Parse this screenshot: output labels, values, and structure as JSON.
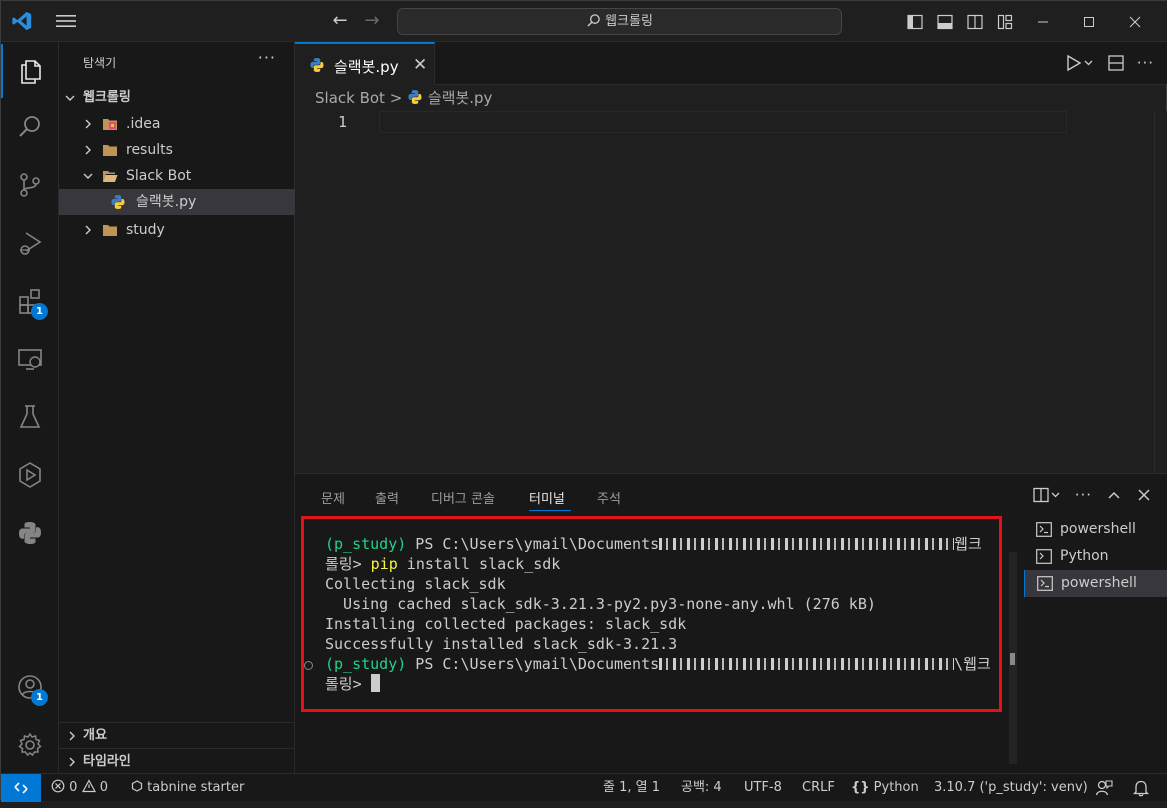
{
  "titlebar": {
    "search_text": "웹크롤링"
  },
  "activity": {
    "extensions_badge": "1",
    "accounts_badge": "1"
  },
  "sidebar": {
    "title": "탐색기",
    "more": "···",
    "root": "웹크롤링",
    "items": [
      {
        "label": ".idea"
      },
      {
        "label": "results"
      },
      {
        "label": "Slack Bot"
      },
      {
        "label": "슬랙봇.py"
      },
      {
        "label": "study"
      }
    ],
    "outline_label": "개요",
    "timeline_label": "타임라인"
  },
  "editor": {
    "tab_label": "슬랙봇.py",
    "tab_close": "✕",
    "breadcrumb_folder": "Slack Bot",
    "breadcrumb_sep": ">",
    "breadcrumb_file": "슬랙봇.py",
    "line_number": "1"
  },
  "panel": {
    "tabs": [
      "문제",
      "출력",
      "디버그 콘솔",
      "터미널",
      "주석"
    ],
    "active_tab": "터미널",
    "terminal": {
      "prompt_env": "(p_study)",
      "prompt_ps": " PS C:\\Users\\ymail\\Documents",
      "path_tail_1": "웹크",
      "path_tail_2": "\\웹크",
      "prompt_end": "롤링>",
      "cmd_pip": "pip",
      "cmd_rest": " install slack_sdk",
      "line3": "Collecting slack_sdk",
      "line4": "  Using cached slack_sdk-3.21.3-py2.py3-none-any.whl (276 kB)",
      "line5": "Installing collected packages: slack_sdk",
      "line6": "Successfully installed slack_sdk-3.21.3"
    },
    "terminal_list": [
      "powershell",
      "Python",
      "powershell"
    ]
  },
  "statusbar": {
    "errors": "0",
    "warnings": "0",
    "tabnine": "tabnine starter",
    "position": "줄 1, 열 1",
    "spaces": "공백: 4",
    "encoding": "UTF-8",
    "eol": "CRLF",
    "language": "Python",
    "interpreter": "3.10.7 ('p_study': venv)"
  },
  "colors": {
    "accent": "#0078d4",
    "highlight_box": "#e5101a",
    "env_green": "#23d18b",
    "cmd_yellow": "#f5f543"
  }
}
